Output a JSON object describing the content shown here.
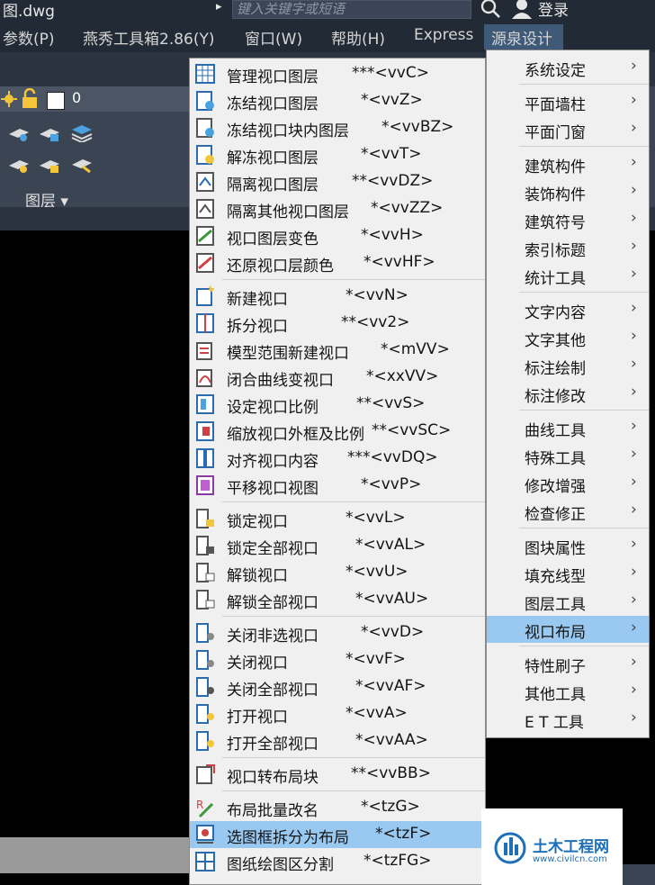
{
  "titlebar": {
    "title": "图.dwg",
    "arrow": "▸",
    "search_placeholder": "键入关键字或短语",
    "login": "登录"
  },
  "menubar": {
    "items": [
      "参数(P)",
      "燕秀工具箱2.86(Y)",
      "窗口(W)",
      "帮助(H)",
      "Express",
      "源泉设计"
    ]
  },
  "ribbon": {
    "layer_number": "0",
    "panel_label": "图层 ▾"
  },
  "menu": {
    "items": [
      {
        "label": "管理视口图层",
        "shortcut": "***<vvC>"
      },
      {
        "label": "冻结视口图层",
        "shortcut": "*<vvZ>"
      },
      {
        "label": "冻结视口块内图层",
        "shortcut": "*<vvBZ>"
      },
      {
        "label": "解冻视口图层",
        "shortcut": "*<vvT>"
      },
      {
        "label": "隔离视口图层",
        "shortcut": "**<vvDZ>"
      },
      {
        "label": "隔离其他视口图层",
        "shortcut": "*<vvZZ>"
      },
      {
        "label": "视口图层变色",
        "shortcut": "*<vvH>"
      },
      {
        "label": "还原视口层颜色",
        "shortcut": "*<vvHF>"
      },
      {
        "label": "新建视口",
        "shortcut": "*<vvN>"
      },
      {
        "label": "拆分视口",
        "shortcut": "**<vv2>"
      },
      {
        "label": "模型范围新建视口",
        "shortcut": "*<mVV>"
      },
      {
        "label": "闭合曲线变视口",
        "shortcut": "*<xxVV>"
      },
      {
        "label": "设定视口比例",
        "shortcut": "**<vvS>"
      },
      {
        "label": "缩放视口外框及比例",
        "shortcut": "**<vvSC>"
      },
      {
        "label": "对齐视口内容",
        "shortcut": "***<vvDQ>"
      },
      {
        "label": "平移视口视图",
        "shortcut": "*<vvP>"
      },
      {
        "label": "锁定视口",
        "shortcut": "*<vvL>"
      },
      {
        "label": "锁定全部视口",
        "shortcut": "*<vvAL>"
      },
      {
        "label": "解锁视口",
        "shortcut": "*<vvU>"
      },
      {
        "label": "解锁全部视口",
        "shortcut": "*<vvAU>"
      },
      {
        "label": "关闭非选视口",
        "shortcut": "*<vvD>"
      },
      {
        "label": "关闭视口",
        "shortcut": "*<vvF>"
      },
      {
        "label": "关闭全部视口",
        "shortcut": "*<vvAF>"
      },
      {
        "label": "打开视口",
        "shortcut": "*<vvA>"
      },
      {
        "label": "打开全部视口",
        "shortcut": "*<vvAA>"
      },
      {
        "label": "视口转布局块",
        "shortcut": "**<vvBB>"
      },
      {
        "label": "布局批量改名",
        "shortcut": "*<tzG>"
      },
      {
        "label": "选图框拆分为布局",
        "shortcut": "*<tzF>"
      },
      {
        "label": "图纸绘图区分割",
        "shortcut": "*<tzFG>"
      }
    ]
  },
  "submenu": {
    "items": [
      "系统设定",
      "平面墙柱",
      "平面门窗",
      "建筑构件",
      "装饰构件",
      "建筑符号",
      "索引标题",
      "统计工具",
      "文字内容",
      "文字其他",
      "标注绘制",
      "标注修改",
      "曲线工具",
      "特殊工具",
      "修改增强",
      "检查修正",
      "图块属性",
      "填充线型",
      "图层工具",
      "视口布局",
      "特性刷子",
      "其他工具",
      "E T 工具"
    ],
    "arrow": "›"
  },
  "logo": {
    "name": "土木工程网",
    "url": "www.civilcn.com"
  },
  "colors": {
    "highlight": "#99c9f1",
    "menu_bg": "#f0f0f0",
    "dark_bar": "#222a35",
    "ribbon": "#3b4452"
  }
}
